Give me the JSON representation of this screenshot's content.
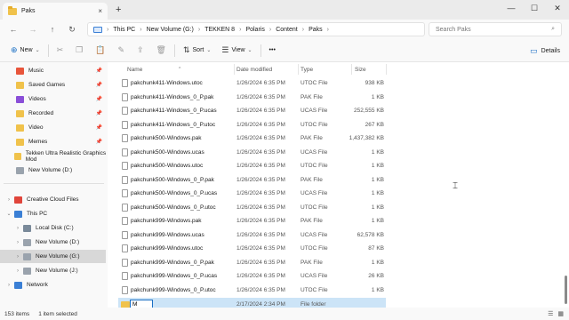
{
  "window": {
    "tab_title": "Paks",
    "new_tab": "+",
    "tab_close": "×",
    "minimize": "—",
    "maximize": "☐",
    "close": "✕"
  },
  "address": {
    "back": "←",
    "forward": "→",
    "up": "↑",
    "refresh": "↻",
    "breadcrumb": [
      "This PC",
      "New Volume (G:)",
      "TEKKEN 8",
      "Polaris",
      "Content",
      "Paks"
    ],
    "separator": "›",
    "expander": "›",
    "search_placeholder": "Search Paks",
    "search_icon": "⌕"
  },
  "toolbar": {
    "new_label": "New",
    "new_icon": "⊕",
    "cut_icon": "✂",
    "copy_icon": "❐",
    "paste_icon": "📋",
    "rename_icon": "✎",
    "share_icon": "⇪",
    "delete_icon": "🗑",
    "sort_label": "Sort",
    "sort_icon": "⇅",
    "view_label": "View",
    "view_icon": "☰",
    "more_label": "•••",
    "details_label": "Details",
    "details_icon": "▭",
    "dropdown": "⌄"
  },
  "nav": {
    "chevron_right": "›",
    "chevron_down": "⌄",
    "pin": "📌",
    "quick_access": [
      {
        "label": "Music",
        "color": "#e8553b"
      },
      {
        "label": "Saved Games",
        "color": "#f0c24b"
      },
      {
        "label": "Videos",
        "color": "#8a4fd8"
      },
      {
        "label": "Recorded",
        "color": "#f0c24b"
      },
      {
        "label": "Video",
        "color": "#f0c24b"
      },
      {
        "label": "Memes",
        "color": "#f0c24b"
      },
      {
        "label": "Tekken Ultra Realistic Graphics Mod",
        "color": "#f0c24b"
      },
      {
        "label": "New Volume (D:)",
        "color": "#9aa3ad"
      }
    ],
    "tree": [
      {
        "label": "Creative Cloud Files",
        "color": "#e0453b",
        "indent": 0,
        "expander": "chevron_right"
      },
      {
        "label": "This PC",
        "color": "#3a7fd5",
        "indent": 0,
        "expander": "chevron_down"
      },
      {
        "label": "Local Disk (C:)",
        "color": "#7a8a9a",
        "indent": 1,
        "expander": "chevron_right"
      },
      {
        "label": "New Volume (D:)",
        "color": "#9aa3ad",
        "indent": 1,
        "expander": "chevron_right"
      },
      {
        "label": "New Volume (G:)",
        "color": "#9aa3ad",
        "indent": 1,
        "expander": "chevron_right",
        "selected": true
      },
      {
        "label": "New Volume (J:)",
        "color": "#9aa3ad",
        "indent": 1,
        "expander": "chevron_right"
      },
      {
        "label": "Network",
        "color": "#3a7fd5",
        "indent": 0,
        "expander": "chevron_right"
      }
    ]
  },
  "columns": {
    "name": "Name",
    "date": "Date modified",
    "type": "Type",
    "size": "Size",
    "sort_indicator": "^"
  },
  "files": [
    {
      "name": "pakchunk411-Windows.utoc",
      "date": "1/26/2024 6:35 PM",
      "type": "UTOC File",
      "size": "938 KB"
    },
    {
      "name": "pakchunk411-Windows_0_P.pak",
      "date": "1/26/2024 6:35 PM",
      "type": "PAK File",
      "size": "1 KB"
    },
    {
      "name": "pakchunk411-Windows_0_P.ucas",
      "date": "1/26/2024 6:35 PM",
      "type": "UCAS File",
      "size": "252,555 KB"
    },
    {
      "name": "pakchunk411-Windows_0_P.utoc",
      "date": "1/26/2024 6:35 PM",
      "type": "UTOC File",
      "size": "267 KB"
    },
    {
      "name": "pakchunk500-Windows.pak",
      "date": "1/26/2024 6:35 PM",
      "type": "PAK File",
      "size": "1,437,382 KB"
    },
    {
      "name": "pakchunk500-Windows.ucas",
      "date": "1/26/2024 6:35 PM",
      "type": "UCAS File",
      "size": "1 KB"
    },
    {
      "name": "pakchunk500-Windows.utoc",
      "date": "1/26/2024 6:35 PM",
      "type": "UTOC File",
      "size": "1 KB"
    },
    {
      "name": "pakchunk500-Windows_0_P.pak",
      "date": "1/26/2024 6:35 PM",
      "type": "PAK File",
      "size": "1 KB"
    },
    {
      "name": "pakchunk500-Windows_0_P.ucas",
      "date": "1/26/2024 6:35 PM",
      "type": "UCAS File",
      "size": "1 KB"
    },
    {
      "name": "pakchunk500-Windows_0_P.utoc",
      "date": "1/26/2024 6:35 PM",
      "type": "UTOC File",
      "size": "1 KB"
    },
    {
      "name": "pakchunk999-Windows.pak",
      "date": "1/26/2024 6:35 PM",
      "type": "PAK File",
      "size": "1 KB"
    },
    {
      "name": "pakchunk999-Windows.ucas",
      "date": "1/26/2024 6:35 PM",
      "type": "UCAS File",
      "size": "62,578 KB"
    },
    {
      "name": "pakchunk999-Windows.utoc",
      "date": "1/26/2024 6:35 PM",
      "type": "UTOC File",
      "size": "87 KB"
    },
    {
      "name": "pakchunk999-Windows_0_P.pak",
      "date": "1/26/2024 6:35 PM",
      "type": "PAK File",
      "size": "1 KB"
    },
    {
      "name": "pakchunk999-Windows_0_P.ucas",
      "date": "1/26/2024 6:35 PM",
      "type": "UCAS File",
      "size": "26 KB"
    },
    {
      "name": "pakchunk999-Windows_0_P.utoc",
      "date": "1/26/2024 6:35 PM",
      "type": "UTOC File",
      "size": "1 KB"
    }
  ],
  "new_folder": {
    "rename_value": "M",
    "date": "2/17/2024 2:34 PM",
    "type": "File folder",
    "size": ""
  },
  "status": {
    "item_count": "153 items",
    "selected": "1 item selected",
    "list_view_icon": "☰",
    "tile_view_icon": "▦"
  },
  "colors": {
    "accent": "#1a6fc4",
    "selection": "#cce4f7",
    "folder": "#f0c24b"
  }
}
